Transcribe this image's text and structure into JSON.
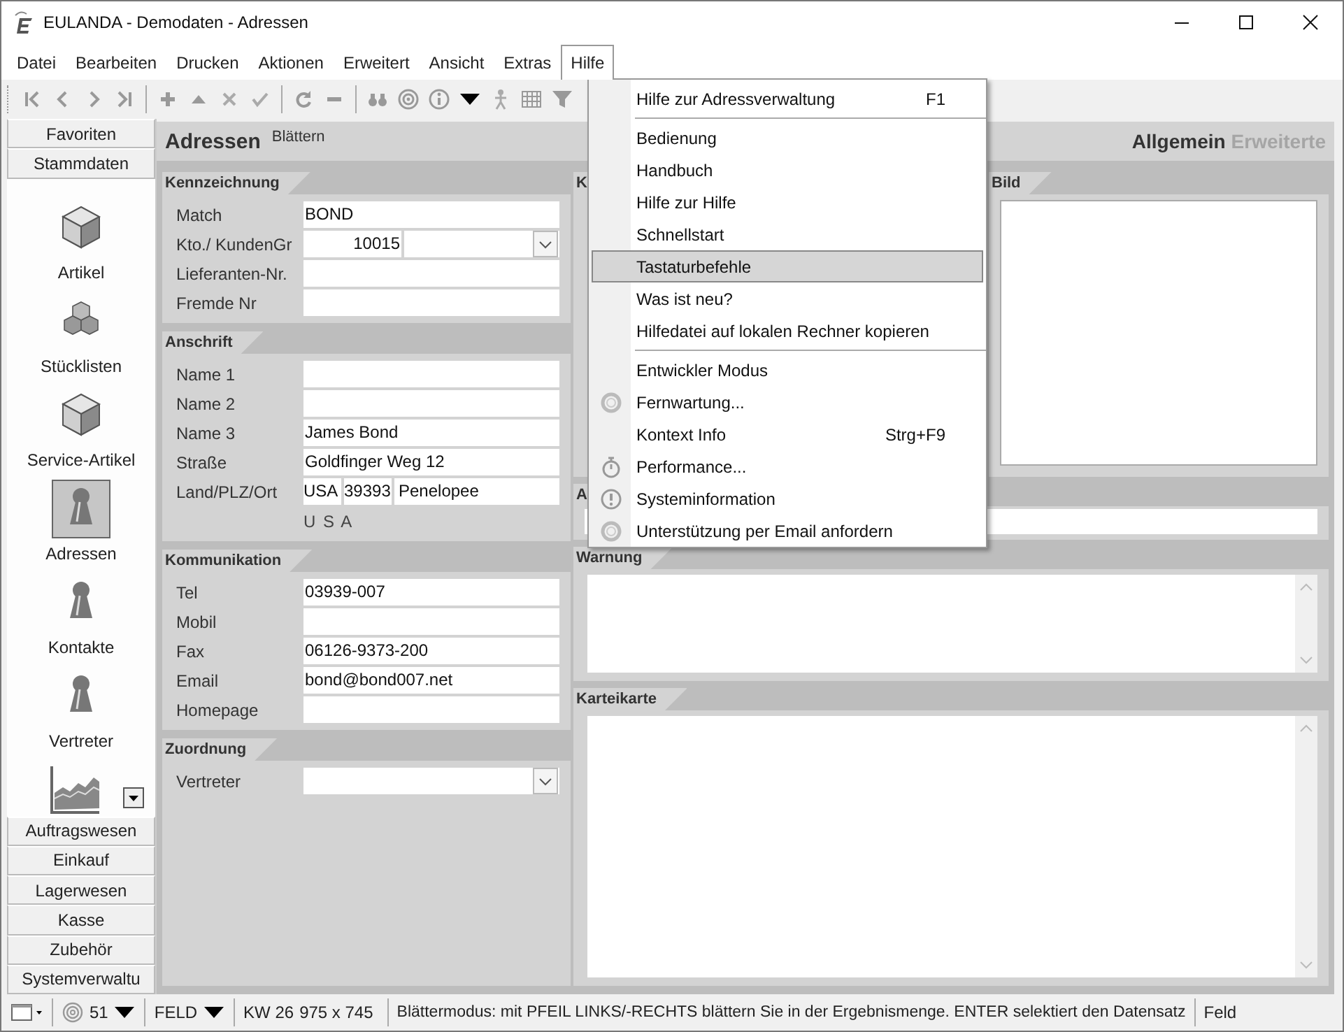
{
  "window": {
    "title": "EULANDA - Demodaten - Adressen"
  },
  "menubar": [
    {
      "label": "Datei",
      "selected": false
    },
    {
      "label": "Bearbeiten",
      "selected": false
    },
    {
      "label": "Drucken",
      "selected": false
    },
    {
      "label": "Aktionen",
      "selected": false
    },
    {
      "label": "Erweitert",
      "selected": false
    },
    {
      "label": "Ansicht",
      "selected": false
    },
    {
      "label": "Extras",
      "selected": false
    },
    {
      "label": "Hilfe",
      "selected": true
    }
  ],
  "sidebar": {
    "top_buttons": [
      "Favoriten",
      "Stammdaten"
    ],
    "items": [
      {
        "label": "Artikel",
        "kind": "cube",
        "selected": false
      },
      {
        "label": "Stücklisten",
        "kind": "cubes",
        "selected": false
      },
      {
        "label": "Service-Artikel",
        "kind": "cube",
        "selected": false
      },
      {
        "label": "Adressen",
        "kind": "pawn",
        "selected": true
      },
      {
        "label": "Kontakte",
        "kind": "pawn",
        "selected": false
      },
      {
        "label": "Vertreter",
        "kind": "pawn",
        "selected": false
      },
      {
        "kind": "chart",
        "selected": false
      }
    ],
    "bottom_buttons": [
      "Auftragswesen",
      "Einkauf",
      "Lagerwesen",
      "Kasse",
      "Zubehör",
      "Systemverwaltu"
    ]
  },
  "page": {
    "title": "Adressen",
    "mode": "Blättern",
    "tabs": [
      {
        "label": "Allgemein",
        "selected": true
      },
      {
        "label": "Erweiterte",
        "selected": false
      }
    ]
  },
  "form_sections": [
    {
      "title": "Kennzeichnung",
      "fields": [
        {
          "label": "Match",
          "kind": "text",
          "value": "BOND"
        },
        {
          "label": "Kto./ KundenGr",
          "kind": "account",
          "value": "10015"
        },
        {
          "label": "Lieferanten-Nr.",
          "kind": "text"
        },
        {
          "label": "Fremde Nr",
          "kind": "text"
        }
      ]
    },
    {
      "title": "Anschrift",
      "fields": [
        {
          "label": "Name 1",
          "kind": "text"
        },
        {
          "label": "Name 2",
          "kind": "text"
        },
        {
          "label": "Name 3",
          "kind": "text",
          "value": "James Bond"
        },
        {
          "label": "Straße",
          "kind": "text",
          "value": "Goldfinger Weg 12"
        },
        {
          "label": "Land/PLZ/Ort",
          "kind": "address",
          "parts": [
            "USA",
            "39393",
            "Penelopee"
          ]
        },
        {
          "kind": "note",
          "value": "U S A"
        }
      ]
    },
    {
      "title": "Kommunikation",
      "fields": [
        {
          "label": "Tel",
          "kind": "text",
          "value": "03939-007"
        },
        {
          "label": "Mobil",
          "kind": "text"
        },
        {
          "label": "Fax",
          "kind": "text",
          "value": "06126-9373-200"
        },
        {
          "label": "Email",
          "kind": "text",
          "value": "bond@bond007.net"
        },
        {
          "label": "Homepage",
          "kind": "text"
        }
      ]
    },
    {
      "title": "Zuordnung",
      "fields": [
        {
          "label": "Vertreter",
          "kind": "combo"
        }
      ]
    }
  ],
  "side_sections": [
    {
      "title": "K",
      "kind": "blank"
    },
    {
      "title": "Bild",
      "kind": "image"
    },
    {
      "title": "A",
      "kind": "line"
    },
    {
      "title": "Warnung",
      "kind": "memo"
    },
    {
      "title": "Karteikarte",
      "kind": "memo"
    }
  ],
  "help_menu": [
    {
      "kind": "item",
      "label": "Hilfe zur Adressverwaltung",
      "shortcut": "F1",
      "selected": false
    },
    {
      "kind": "separator"
    },
    {
      "kind": "item",
      "label": "Bedienung",
      "selected": false
    },
    {
      "kind": "item",
      "label": "Handbuch",
      "selected": false
    },
    {
      "kind": "item",
      "label": "Hilfe zur Hilfe",
      "selected": false
    },
    {
      "kind": "item",
      "label": "Schnellstart",
      "selected": false
    },
    {
      "kind": "item",
      "label": "Tastaturbefehle",
      "selected": true
    },
    {
      "kind": "item",
      "label": "Was ist neu?",
      "selected": false
    },
    {
      "kind": "item",
      "label": "Hilfedatei auf lokalen Rechner kopieren",
      "selected": false
    },
    {
      "kind": "separator"
    },
    {
      "kind": "item",
      "label": "Entwickler Modus",
      "selected": false
    },
    {
      "kind": "item",
      "label": "Fernwartung...",
      "selected": false
    },
    {
      "kind": "item",
      "label": "Kontext Info",
      "shortcut": "Strg+F9",
      "selected": false
    },
    {
      "kind": "item",
      "label": "Performance...",
      "selected": false
    },
    {
      "kind": "item",
      "label": "Systeminformation",
      "selected": false
    },
    {
      "kind": "item",
      "label": "Unterstützung per Email anfordern",
      "selected": false
    }
  ],
  "status_bar": {
    "zoom": "51",
    "field_mode": "FELD",
    "week": "KW 26",
    "size": "975 x 745",
    "message": "Blättermodus: mit PFEIL LINKS/-RECHTS blättern Sie in der Ergebnismenge. ENTER selektiert den Datensatz",
    "field": "Feld"
  }
}
